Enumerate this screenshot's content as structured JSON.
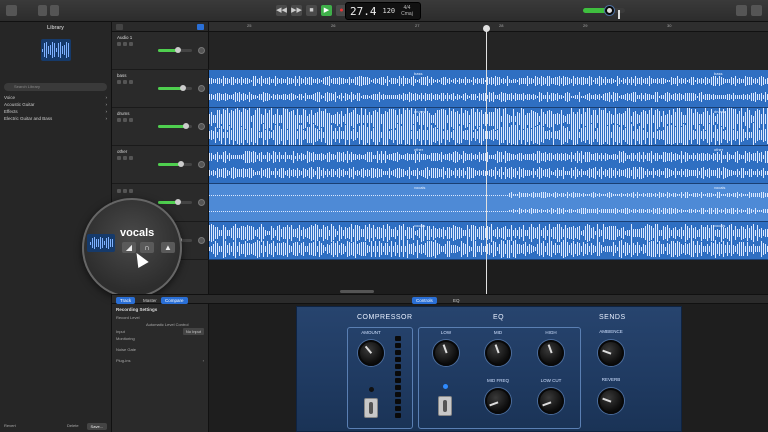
{
  "library": {
    "title": "Library",
    "search_placeholder": "Search Library",
    "items": [
      {
        "label": "Voice"
      },
      {
        "label": "Acoustic Guitar"
      },
      {
        "label": "Effects"
      },
      {
        "label": "Electric Guitar and Bass"
      }
    ],
    "footer": {
      "revert": "Revert",
      "delete": "Delete",
      "save": "Save..."
    }
  },
  "transport": {
    "position": "27.4",
    "tempo": "120",
    "time_sig_top": "4/4",
    "time_sig_bottom": "Cmaj",
    "master_volume": 0.6
  },
  "ruler": {
    "marks": [
      "25",
      "26",
      "27",
      "28",
      "29",
      "30"
    ]
  },
  "tracks": [
    {
      "name": "Audio 1",
      "volume": 0.6
    },
    {
      "name": "bass",
      "volume": 0.8
    },
    {
      "name": "drums",
      "volume": 0.9
    },
    {
      "name": "other",
      "volume": 0.7
    },
    {
      "name": "",
      "volume": 0.6
    },
    {
      "name": "",
      "volume": 0.65
    }
  ],
  "lanes": [
    {
      "label": "bass"
    },
    {
      "label": "drums"
    },
    {
      "label": "other"
    },
    {
      "label": "vocals"
    },
    {
      "label": "vocals"
    }
  ],
  "magnifier": {
    "label": "vocals"
  },
  "smart_controls": {
    "tabs": {
      "track": "Track",
      "master": "Master",
      "compare": "Compare",
      "controls": "Controls",
      "eq": "EQ"
    },
    "settings": {
      "heading": "Recording Settings",
      "record_level": "Record Level",
      "auto_level": "Automatic Level Control",
      "input_label": "Input",
      "input_value": "No Input",
      "monitoring": "Monitoring",
      "noise_gate": "Noise Gate",
      "plugins": "Plug-ins"
    }
  },
  "plugin": {
    "compressor": {
      "title": "COMPRESSOR",
      "amount": "AMOUNT"
    },
    "eq": {
      "title": "EQ",
      "low": "LOW",
      "mid": "MID",
      "high": "HIGH",
      "mid_freq": "MID FREQ",
      "low_cut": "LOW CUT"
    },
    "sends": {
      "title": "SENDS",
      "ambience": "AMBIENCE",
      "reverb": "REVERB"
    }
  }
}
